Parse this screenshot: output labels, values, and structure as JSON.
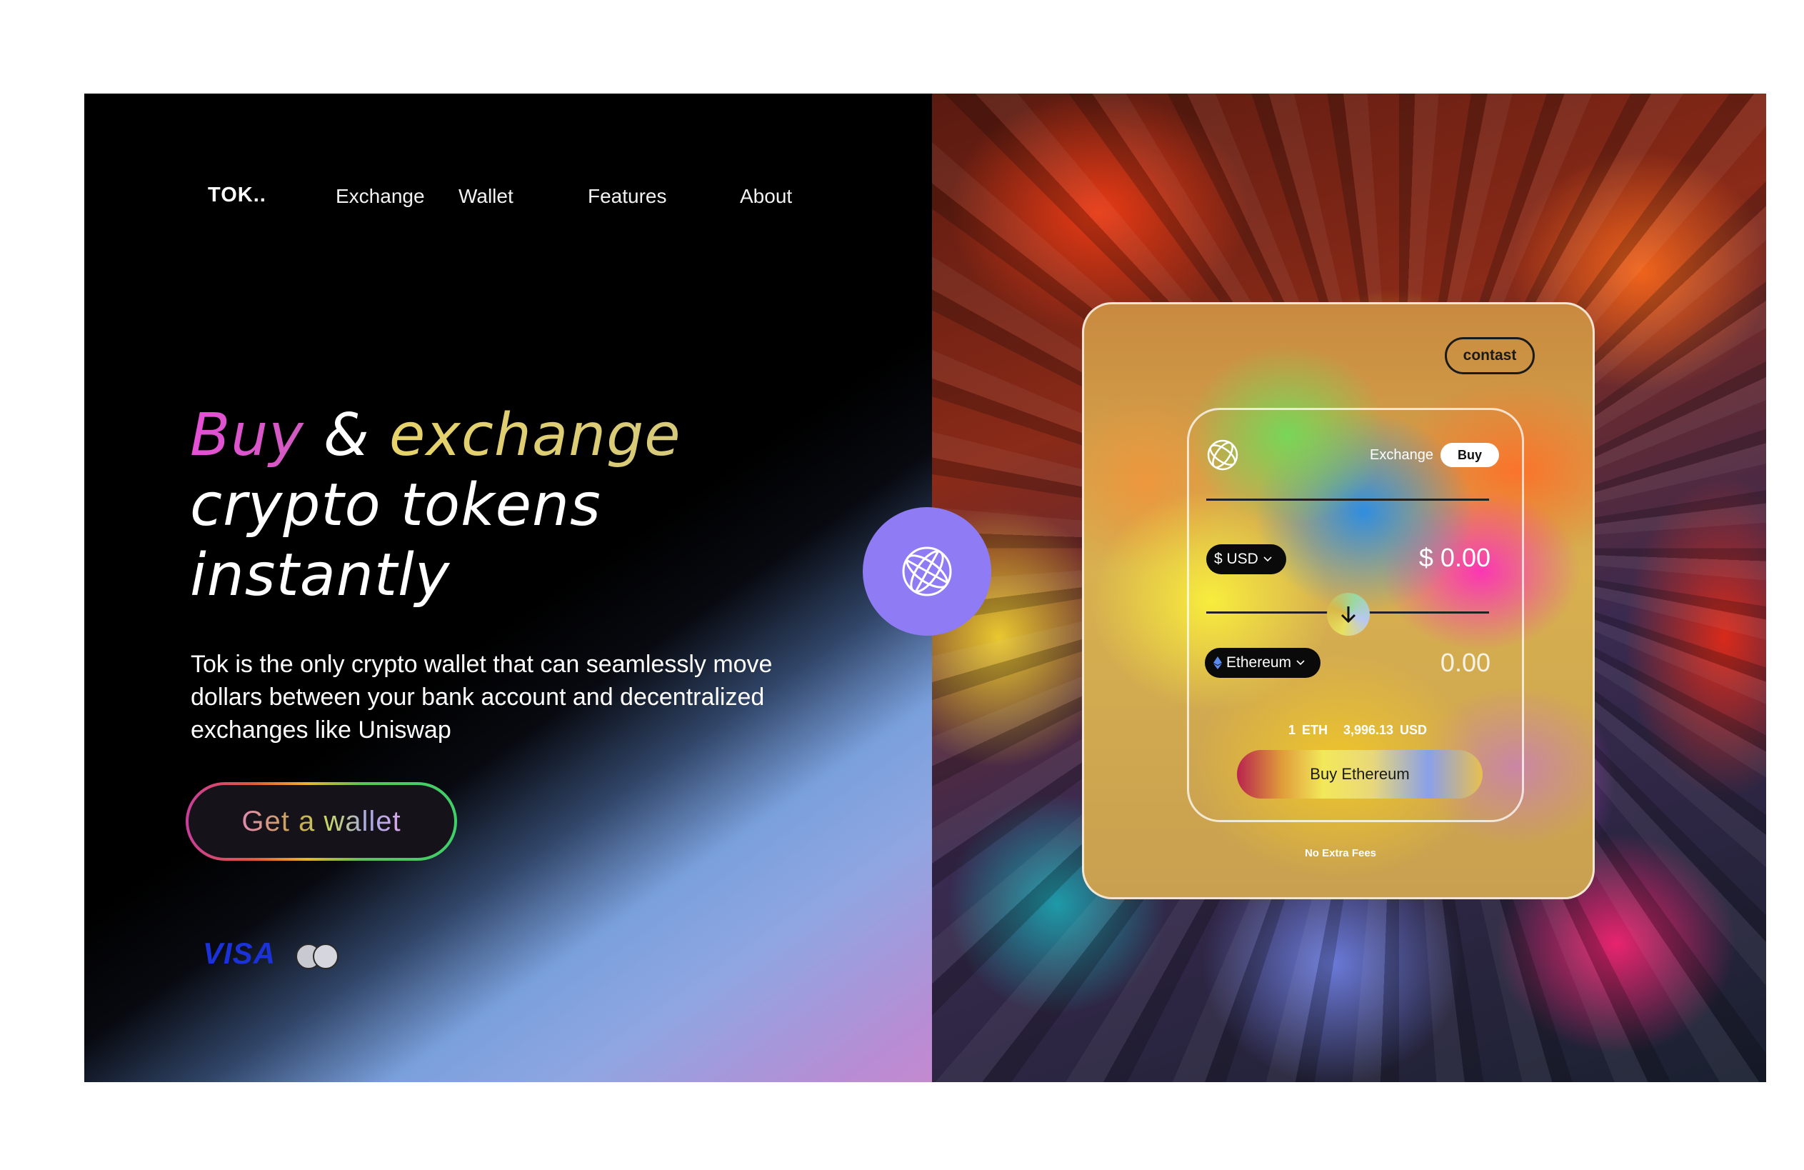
{
  "nav": {
    "logo": "TOK..",
    "links": [
      "Exchange",
      "Wallet",
      "Features",
      "About"
    ]
  },
  "hero": {
    "headline_buy": "Buy",
    "headline_amp": " & ",
    "headline_exchange": "exchange",
    "headline_line2": "crypto tokens",
    "headline_line3": "instantly",
    "description": "Tok is the only crypto wallet that can seamlessly move dollars between your bank account and decentralized exchanges like Uniswap",
    "cta_label": "Get a wallet"
  },
  "payments": {
    "visa": "VISA",
    "mastercard_icon": "mastercard-icon"
  },
  "widget": {
    "contact_label": "contast",
    "tab_exchange": "Exchange",
    "tab_buy": "Buy",
    "currency_from": "$ USD",
    "amount_from": "$ 0.00",
    "currency_to": "Ethereum",
    "amount_to": "0.00",
    "rate_eth": "1 ETH",
    "rate_usd": "3,996.13 USD",
    "buy_label": "Buy Ethereum",
    "fees_note": "No Extra Fees"
  },
  "colors": {
    "orb": "#8f7cf4",
    "visa": "#1a32d8",
    "headline_buy": "#e64fd6",
    "headline_exchange": "#e7d36a"
  }
}
